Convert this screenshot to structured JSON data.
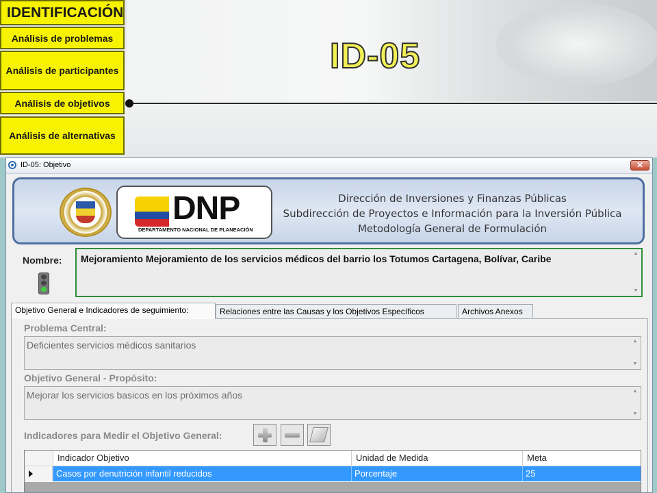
{
  "slide": {
    "title": "ID-05",
    "menu": {
      "identificacion": "IDENTIFICACIÓN",
      "problemas": "Análisis de problemas",
      "participantes": "Análisis de participantes",
      "objetivos": "Análisis de objetivos",
      "alternativas": "Análisis de alternativas"
    }
  },
  "window": {
    "title": "ID-05: Objetivo",
    "close_label": "✕"
  },
  "banner": {
    "logo_text": "DNP",
    "logo_subtext": "DEPARTAMENTO NACIONAL DE PLANEACIÓN",
    "line1": "Dirección de Inversiones y Finanzas Públicas",
    "line2": "Subdirección de Proyectos e Información para la Inversión Pública",
    "line3": "Metodología General de Formulación"
  },
  "nombre": {
    "label": "Nombre:",
    "value": "Mejoramiento Mejoramiento de los servicios médicos del barrio los Totumos Cartagena, Bolívar, Caribe",
    "status_icon": "traffic-light-green"
  },
  "tabs": [
    {
      "label": "Objetivo General e Indicadores de seguimiento:",
      "active": true
    },
    {
      "label": "Relaciones entre las Causas y los Objetivos Específicos",
      "active": false
    },
    {
      "label": "Archivos Anexos",
      "active": false
    }
  ],
  "form": {
    "problema_label": "Problema Central:",
    "problema_value": "Deficientes servicios médicos sanitarios",
    "objetivo_label": "Objetivo General - Propósito:",
    "objetivo_value": "Mejorar los servicios basicos en los próximos años",
    "indicadores_label": "Indicadores para Medir el Objetivo General:"
  },
  "grid": {
    "columns": [
      "Indicador Objetivo",
      "Unidad de Medida",
      "Meta"
    ],
    "rows": [
      [
        "Casos por denutrición infantil reducidos",
        "Porcentaje",
        "25"
      ]
    ]
  },
  "colors": {
    "menu_yellow": "#f7f300",
    "selection_blue": "#3399ff",
    "nombre_border": "#2f8f3a",
    "banner_border": "#4e6ea0"
  }
}
